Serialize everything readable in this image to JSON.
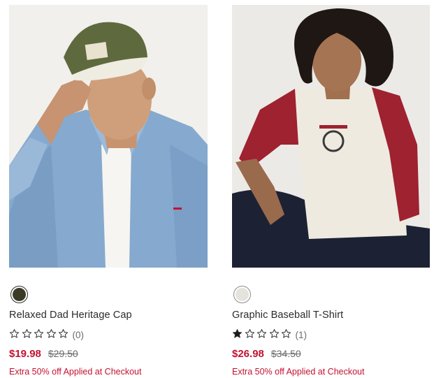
{
  "products": [
    {
      "name": "Relaxed Dad Heritage Cap",
      "swatch_color": "#3b3a26",
      "rating_stars": 0,
      "rating_count": "(0)",
      "sale_price": "$19.98",
      "original_price": "$29.50",
      "promo": "Extra 50% off Applied at Checkout"
    },
    {
      "name": "Graphic Baseball T-Shirt",
      "swatch_color": "#e6e3dc",
      "rating_stars": 1,
      "rating_count": "(1)",
      "sale_price": "$26.98",
      "original_price": "$34.50",
      "promo": "Extra 50% off Applied at Checkout"
    }
  ],
  "colors": {
    "sale_red": "#c41230",
    "text": "#2b2b2b",
    "muted": "#6b6b6b"
  }
}
